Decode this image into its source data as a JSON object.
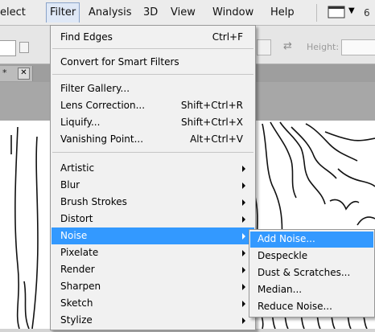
{
  "menubar": {
    "items": [
      "elect",
      "Filter",
      "Analysis",
      "3D",
      "View",
      "Window",
      "Help"
    ],
    "active_index": 1,
    "zoom_partial": "6"
  },
  "options_bar": {
    "height_label": "Height:"
  },
  "document_tab": {
    "label": "*",
    "close_glyph": "✕"
  },
  "filter_menu": {
    "groups": [
      [
        {
          "label": "Find Edges",
          "shortcut": "Ctrl+F"
        }
      ],
      [
        {
          "label": "Convert for Smart Filters"
        }
      ],
      [
        {
          "label": "Filter Gallery..."
        },
        {
          "label": "Lens Correction...",
          "shortcut": "Shift+Ctrl+R"
        },
        {
          "label": "Liquify...",
          "shortcut": "Shift+Ctrl+X"
        },
        {
          "label": "Vanishing Point...",
          "shortcut": "Alt+Ctrl+V"
        }
      ],
      [
        {
          "label": "Artistic",
          "submenu": true
        },
        {
          "label": "Blur",
          "submenu": true
        },
        {
          "label": "Brush Strokes",
          "submenu": true
        },
        {
          "label": "Distort",
          "submenu": true
        },
        {
          "label": "Noise",
          "submenu": true,
          "highlighted": true
        },
        {
          "label": "Pixelate",
          "submenu": true
        },
        {
          "label": "Render",
          "submenu": true
        },
        {
          "label": "Sharpen",
          "submenu": true
        },
        {
          "label": "Sketch",
          "submenu": true
        },
        {
          "label": "Stylize",
          "submenu": true
        }
      ]
    ]
  },
  "noise_submenu": {
    "items": [
      {
        "label": "Add Noise...",
        "highlighted": true
      },
      {
        "label": "Despeckle"
      },
      {
        "label": "Dust & Scratches..."
      },
      {
        "label": "Median..."
      },
      {
        "label": "Reduce Noise..."
      }
    ]
  },
  "colors": {
    "highlight": "#3399ff",
    "menu_bg": "#f1f1f1"
  }
}
